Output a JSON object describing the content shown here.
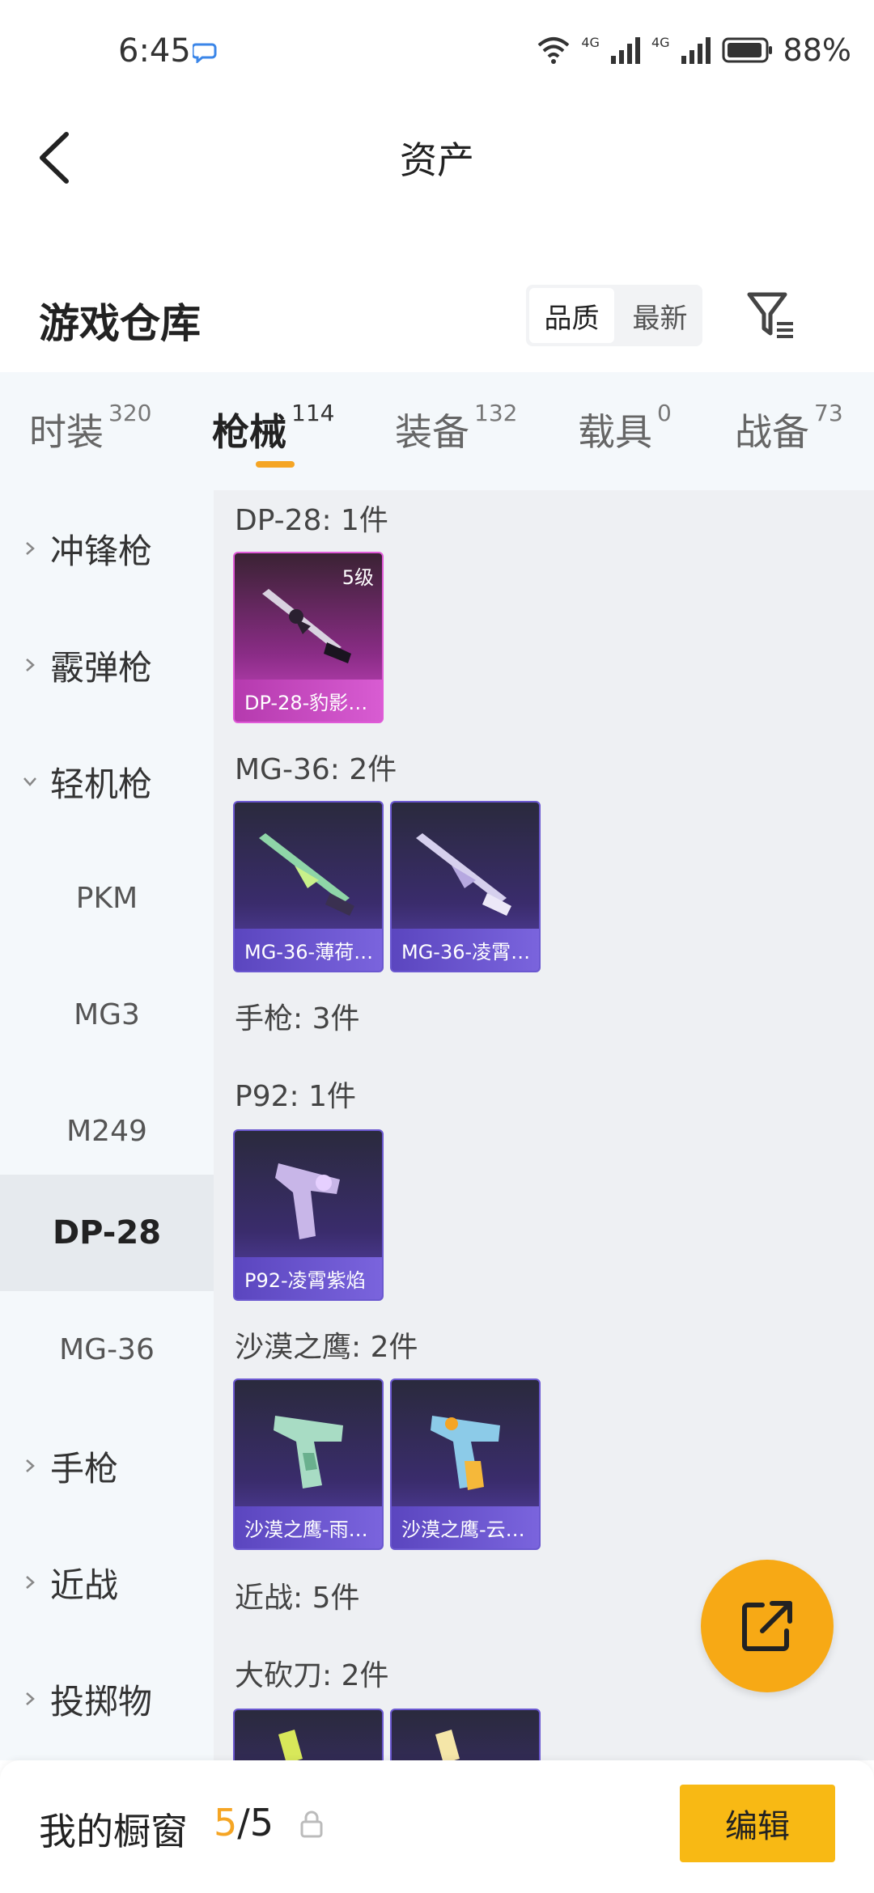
{
  "status": {
    "time": "6:45",
    "network1": "4G",
    "network2": "4G",
    "battery": "88%"
  },
  "header": {
    "title": "资产"
  },
  "warehouse": {
    "title": "游戏仓库",
    "sort_quality": "品质",
    "sort_newest": "最新"
  },
  "tabs": [
    {
      "label": "时装",
      "count": "320"
    },
    {
      "label": "枪械",
      "count": "114"
    },
    {
      "label": "装备",
      "count": "132"
    },
    {
      "label": "载具",
      "count": "0"
    },
    {
      "label": "战备",
      "count": "73"
    }
  ],
  "sidebar": {
    "items": [
      {
        "label": "冲锋枪"
      },
      {
        "label": "霰弹枪"
      },
      {
        "label": "轻机枪"
      },
      {
        "label": "PKM"
      },
      {
        "label": "MG3"
      },
      {
        "label": "M249"
      },
      {
        "label": "DP-28"
      },
      {
        "label": "MG-36"
      },
      {
        "label": "手枪"
      },
      {
        "label": "近战"
      },
      {
        "label": "投掷物"
      }
    ]
  },
  "content": {
    "groups": [
      {
        "title": "DP-28: 1件"
      },
      {
        "title": "MG-36: 2件"
      },
      {
        "title": "手枪: 3件"
      },
      {
        "title": "P92: 1件"
      },
      {
        "title": "沙漠之鹰: 2件"
      },
      {
        "title": "近战: 5件"
      },
      {
        "title": "大砍刀: 2件"
      }
    ],
    "cards": [
      {
        "name": "DP-28-豹影…",
        "level": "5级"
      },
      {
        "name": "MG-36-薄荷…"
      },
      {
        "name": "MG-36-凌霄…"
      },
      {
        "name": "P92-凌霄紫焰"
      },
      {
        "name": "沙漠之鹰-雨…"
      },
      {
        "name": "沙漠之鹰-云…"
      }
    ]
  },
  "bottom": {
    "title": "我的橱窗",
    "current": "5",
    "total": "/5",
    "edit": "编辑"
  },
  "colors": {
    "accent": "#f5a524",
    "button": "#f8b914",
    "card_purple": "#5b46bf",
    "card_magenta": "#d04ac8"
  }
}
